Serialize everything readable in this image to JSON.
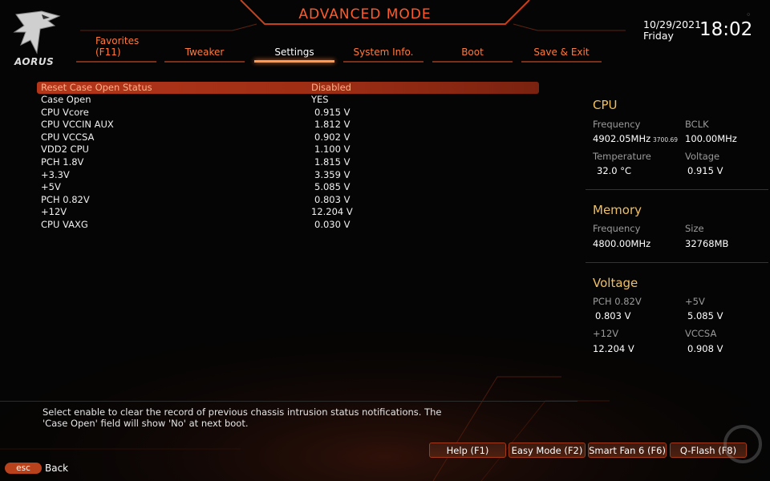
{
  "header": {
    "mode_title": "ADVANCED MODE",
    "logo_text": "AORUS",
    "date": "10/29/2021",
    "day": "Friday",
    "time": "18:02"
  },
  "tabs": [
    {
      "label": "Favorites\n(F11)",
      "active": false
    },
    {
      "label": "Tweaker",
      "active": false
    },
    {
      "label": "Settings",
      "active": true
    },
    {
      "label": "System Info.",
      "active": false
    },
    {
      "label": "Boot",
      "active": false
    },
    {
      "label": "Save & Exit",
      "active": false
    }
  ],
  "settings": [
    {
      "label": "Reset Case Open Status",
      "value": "Disabled",
      "selected": true
    },
    {
      "label": "Case Open",
      "value": "YES"
    },
    {
      "label": "CPU Vcore",
      "value": "0.915 V"
    },
    {
      "label": "CPU VCCIN AUX",
      "value": "1.812 V"
    },
    {
      "label": "CPU VCCSA",
      "value": "0.902 V"
    },
    {
      "label": "VDD2 CPU",
      "value": "1.100 V"
    },
    {
      "label": "PCH 1.8V",
      "value": "1.815 V"
    },
    {
      "label": "+3.3V",
      "value": "3.359 V"
    },
    {
      "label": "+5V",
      "value": "5.085 V"
    },
    {
      "label": "PCH 0.82V",
      "value": "0.803 V"
    },
    {
      "label": "+12V",
      "value": "12.204 V"
    },
    {
      "label": "CPU VAXG",
      "value": "0.030 V"
    }
  ],
  "cpu": {
    "title": "CPU",
    "freq_label": "Frequency",
    "freq_value": "4902.05MHz",
    "freq_sub": "3700.69",
    "bclk_label": "BCLK",
    "bclk_value": "100.00MHz",
    "temp_label": "Temperature",
    "temp_value": "32.0 °C",
    "volt_label": "Voltage",
    "volt_value": "0.915 V"
  },
  "memory": {
    "title": "Memory",
    "freq_label": "Frequency",
    "freq_value": "4800.00MHz",
    "size_label": "Size",
    "size_value": "32768MB"
  },
  "voltage": {
    "title": "Voltage",
    "pch_label": "PCH 0.82V",
    "pch_value": "0.803 V",
    "p5_label": "+5V",
    "p5_value": "5.085 V",
    "p12_label": "+12V",
    "p12_value": "12.204 V",
    "vccsa_label": "VCCSA",
    "vccsa_value": "0.908 V"
  },
  "help_text": "Select enable to clear the record of previous chassis intrusion status notifications. The 'Case Open' field will show 'No' at next boot.",
  "footer": {
    "help": "Help (F1)",
    "easy": "Easy Mode (F2)",
    "fan": "Smart Fan 6 (F6)",
    "qflash": "Q-Flash (F8)",
    "esc": "esc",
    "back": "Back"
  },
  "colors": {
    "accent": "#ff5a2a",
    "selected_row": "#b4361a",
    "section_title": "#f0c060"
  }
}
